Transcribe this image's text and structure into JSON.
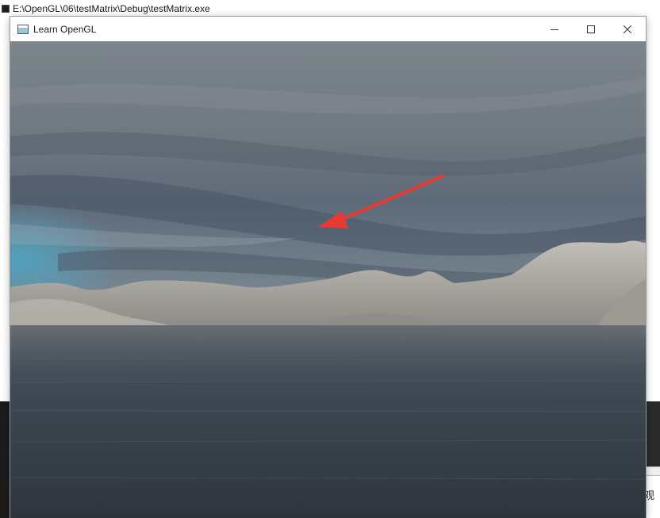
{
  "console": {
    "title": "E:\\OpenGL\\06\\testMatrix\\Debug\\testMatrix.exe",
    "side_text": "观"
  },
  "gl_window": {
    "title": "Learn OpenGL",
    "controls": {
      "minimize_icon": "minimize-icon",
      "maximize_icon": "maximize-icon",
      "close_icon": "close-icon"
    }
  },
  "scene": {
    "sky_color": "#6c747c",
    "water_color": "#3a4148",
    "mountain_color": "#a6a39c",
    "arrow_color": "#e63a32"
  }
}
